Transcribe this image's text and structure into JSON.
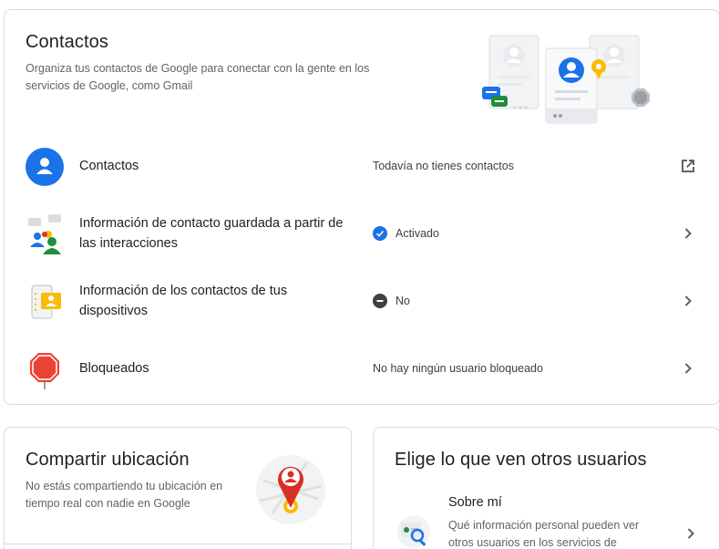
{
  "contacts_card": {
    "title": "Contactos",
    "description": "Organiza tus contactos de Google para conectar con la gente en los servicios de Google, como Gmail",
    "rows": [
      {
        "label": "Contactos",
        "status": "Todavía no tienes contactos",
        "icon": "person-avatar-icon",
        "action_icon": "open-external-icon"
      },
      {
        "label": "Información de contacto guardada a partir de las interacciones",
        "status": "Activado",
        "status_icon": "check-circle-icon",
        "icon": "interactions-icon",
        "action_icon": "chevron-right-icon"
      },
      {
        "label": "Información de los contactos de tus dispositivos",
        "status": "No",
        "status_icon": "minus-circle-icon",
        "icon": "device-contacts-icon",
        "action_icon": "chevron-right-icon"
      },
      {
        "label": "Bloqueados",
        "status": "No hay ningún usuario bloqueado",
        "icon": "stop-sign-icon",
        "action_icon": "chevron-right-icon"
      }
    ]
  },
  "location_card": {
    "title": "Compartir ubicación",
    "description": "No estás compartiendo tu ubicación en tiempo real con nadie en Google",
    "icon": "location-pin-icon"
  },
  "visibility_card": {
    "title": "Elige lo que ven otros usuarios",
    "item": {
      "label": "Sobre mí",
      "description": "Qué información personal pueden ver otros usuarios en los servicios de",
      "icon": "about-me-icon",
      "action_icon": "chevron-right-icon"
    }
  },
  "colors": {
    "blue": "#1a73e8",
    "grey_text": "#5f6368",
    "border": "#dadce0",
    "red": "#d93025",
    "yellow": "#fbbc04",
    "green": "#1e8e3e"
  }
}
